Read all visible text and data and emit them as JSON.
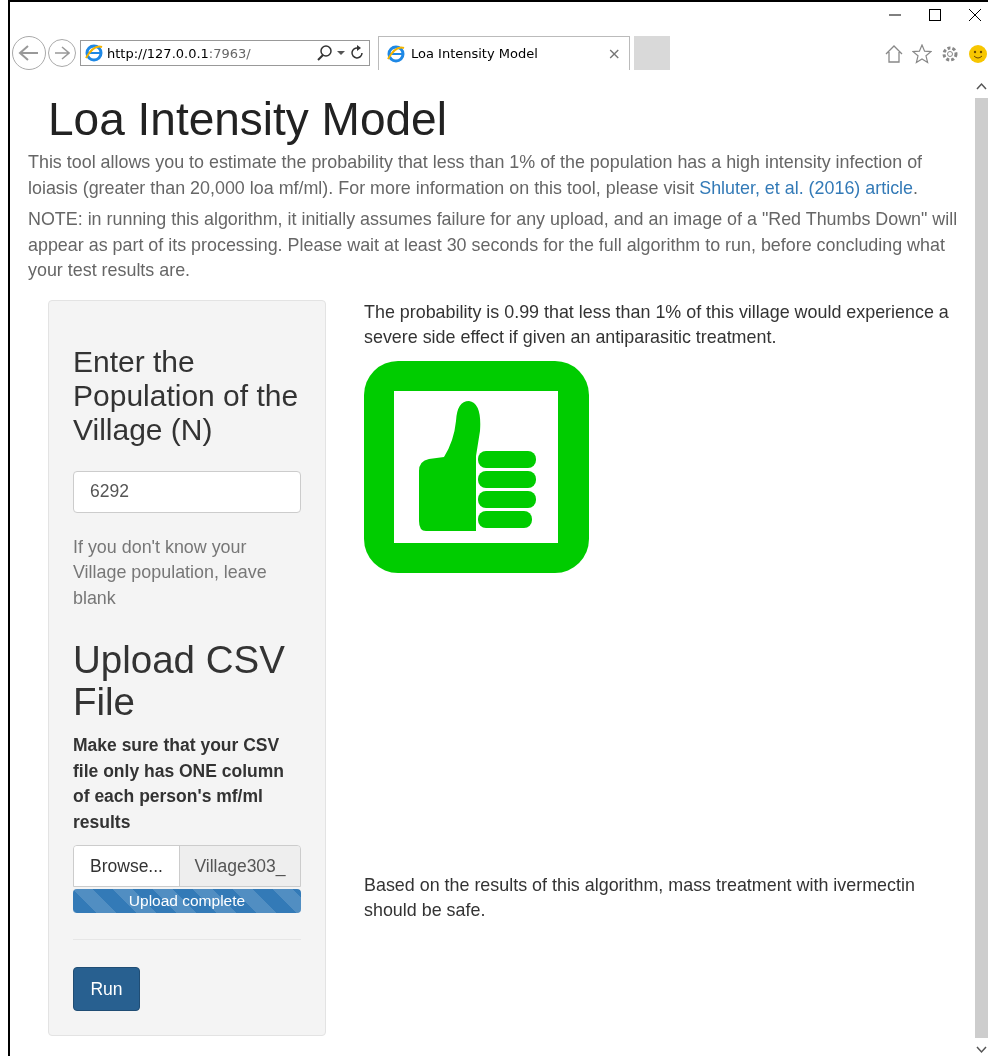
{
  "browser": {
    "url_host": "http://127.0.0.1",
    "url_port": ":7963/",
    "tab": {
      "title": "Loa Intensity Model",
      "close": "×",
      "selected": true
    }
  },
  "page": {
    "title": "Loa Intensity Model",
    "intro": "This tool allows you to estimate the probability that less than 1% of the population has a high intensity infection of loiasis (greater than 20,000 loa mf/ml). For more information on this tool, please visit ",
    "link": "Shluter, et al. (2016) article",
    "intro_end": ".",
    "note": "NOTE: in running this algorithm, it initially assumes failure for any upload, and an image of a \"Red Thumbs Down\" will appear as part of its processing. Please wait at least 30 seconds for the full algorithm to run, before concluding what your test results are.",
    "sidebar": {
      "population_heading": "Enter the Population of the Village (N)",
      "population_value": "6292",
      "population_help": "If you don't know your Village population, leave blank",
      "upload_heading": "Upload CSV File",
      "upload_instructions": "Make sure that your CSV file only has ONE column of each person's mf/ml results",
      "browse_button": "Browse...",
      "file_name": "Village303_",
      "upload": {
        "label": "Upload complete",
        "level": 1
      },
      "run_button": "Run"
    },
    "results": {
      "probability_text": "The probability is 0.99 that less than 1% of this village would experience a severe side effect if given an antiparasitic treatment.",
      "verdict_icon": {
        "kind": "thumbs_up"
      },
      "conclusion": "Based on the results of this algorithm, mass treatment with ivermectin should be safe."
    }
  }
}
